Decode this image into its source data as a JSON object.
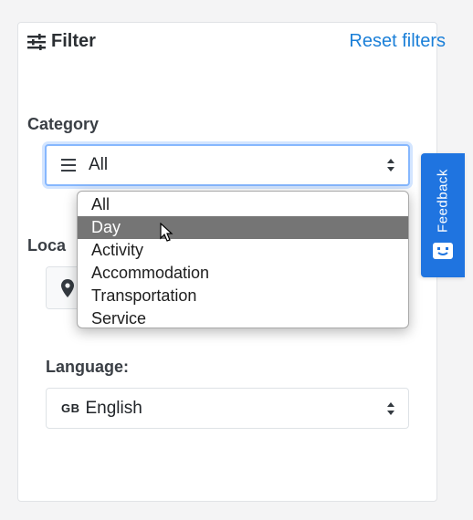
{
  "filter": {
    "title": "Filter",
    "reset_label": "Reset filters"
  },
  "category": {
    "label": "Category",
    "selected": "All",
    "options": [
      "All",
      "Day",
      "Activity",
      "Accommodation",
      "Transportation",
      "Service"
    ],
    "hovered": "Day"
  },
  "location": {
    "label": "Loca",
    "icon": "map-marker-icon"
  },
  "language": {
    "label": "Language:",
    "flag": "GB",
    "selected": "English"
  },
  "feedback": {
    "label": "Feedback",
    "icon": "chat-bot-icon"
  },
  "colors": {
    "accent": "#1a7fd8",
    "feedback_bg": "#1f74e0",
    "focus_ring": "#86b7fe",
    "hover_bg": "#757575"
  }
}
